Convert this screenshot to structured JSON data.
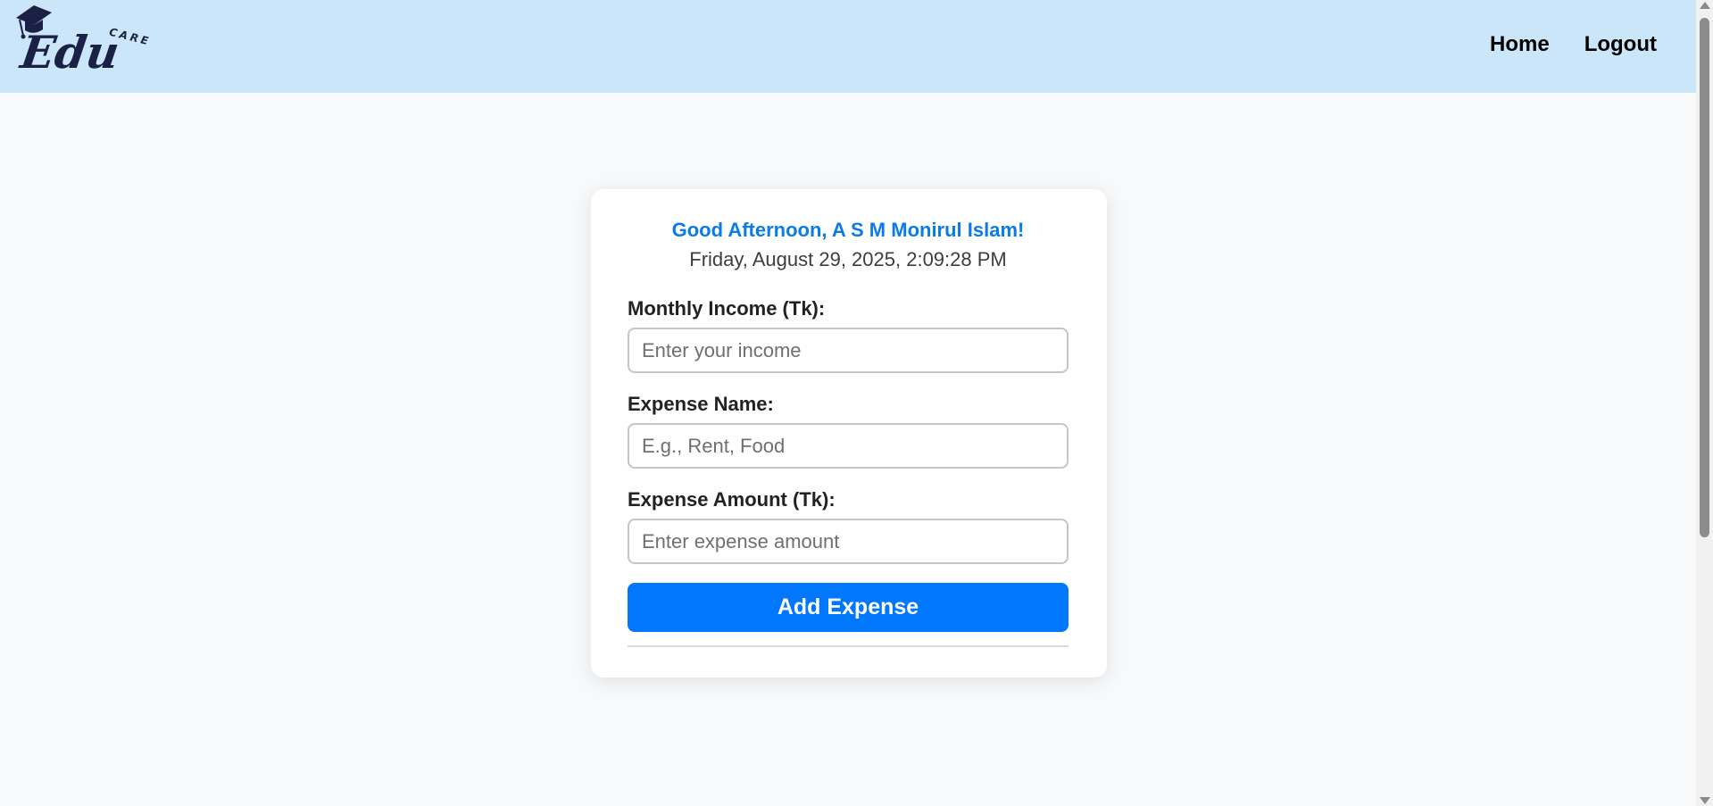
{
  "navbar": {
    "logo": {
      "main_text": "Edu",
      "sub_text": "CARE",
      "icon": "graduation-cap-icon"
    },
    "links": [
      {
        "label": "Home"
      },
      {
        "label": "Logout"
      }
    ],
    "background_color": "#cce6f9"
  },
  "card": {
    "greeting": "Good Afternoon, A S M Monirul Islam!",
    "datetime": "Friday, August 29, 2025, 2:09:28 PM",
    "fields": {
      "income": {
        "label": "Monthly Income (Tk):",
        "placeholder": "Enter your income",
        "value": ""
      },
      "expense_name": {
        "label": "Expense Name:",
        "placeholder": "E.g., Rent, Food",
        "value": ""
      },
      "expense_amount": {
        "label": "Expense Amount (Tk):",
        "placeholder": "Enter expense amount",
        "value": ""
      }
    },
    "submit_label": "Add Expense",
    "accent_color": "#0077fd",
    "greeting_color": "#0a7bea"
  }
}
